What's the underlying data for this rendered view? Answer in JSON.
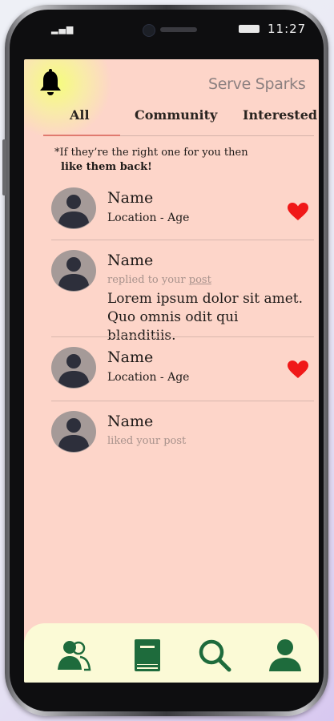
{
  "status_bar": {
    "signal": "▂▄▆",
    "time": "11:27"
  },
  "header": {
    "brand": "Serve Sparks"
  },
  "tabs": [
    {
      "label": "All",
      "active": true
    },
    {
      "label": "Community",
      "active": false
    },
    {
      "label": "Interested",
      "active": false
    }
  ],
  "note": {
    "line1": "*If they’re the right one for you then",
    "line2": "like them back!"
  },
  "items": [
    {
      "name": "Name",
      "subtitle": "Location - Age",
      "liked": true
    },
    {
      "name": "Name",
      "subtitle_prefix": "replied to your ",
      "subtitle_link": "post",
      "message_line1": "Lorem ipsum dolor sit amet.",
      "message_line2": "Quo omnis odit qui blanditiis."
    },
    {
      "name": "Name",
      "subtitle": "Location - Age",
      "liked": true
    },
    {
      "name": "Name",
      "subtitle": "liked your post"
    }
  ],
  "bottom_nav": [
    {
      "icon": "people-icon"
    },
    {
      "icon": "book-icon"
    },
    {
      "icon": "search-icon"
    },
    {
      "icon": "profile-icon"
    }
  ],
  "colors": {
    "screen_bg": "#fdd5c9",
    "nav_bg": "#fbfad6",
    "accent_green": "#1e6b3c",
    "heart_red": "#f01818",
    "tab_underline": "#e07a6f",
    "avatar_bg": "#a59a98",
    "avatar_fg": "#2d2f3b"
  }
}
